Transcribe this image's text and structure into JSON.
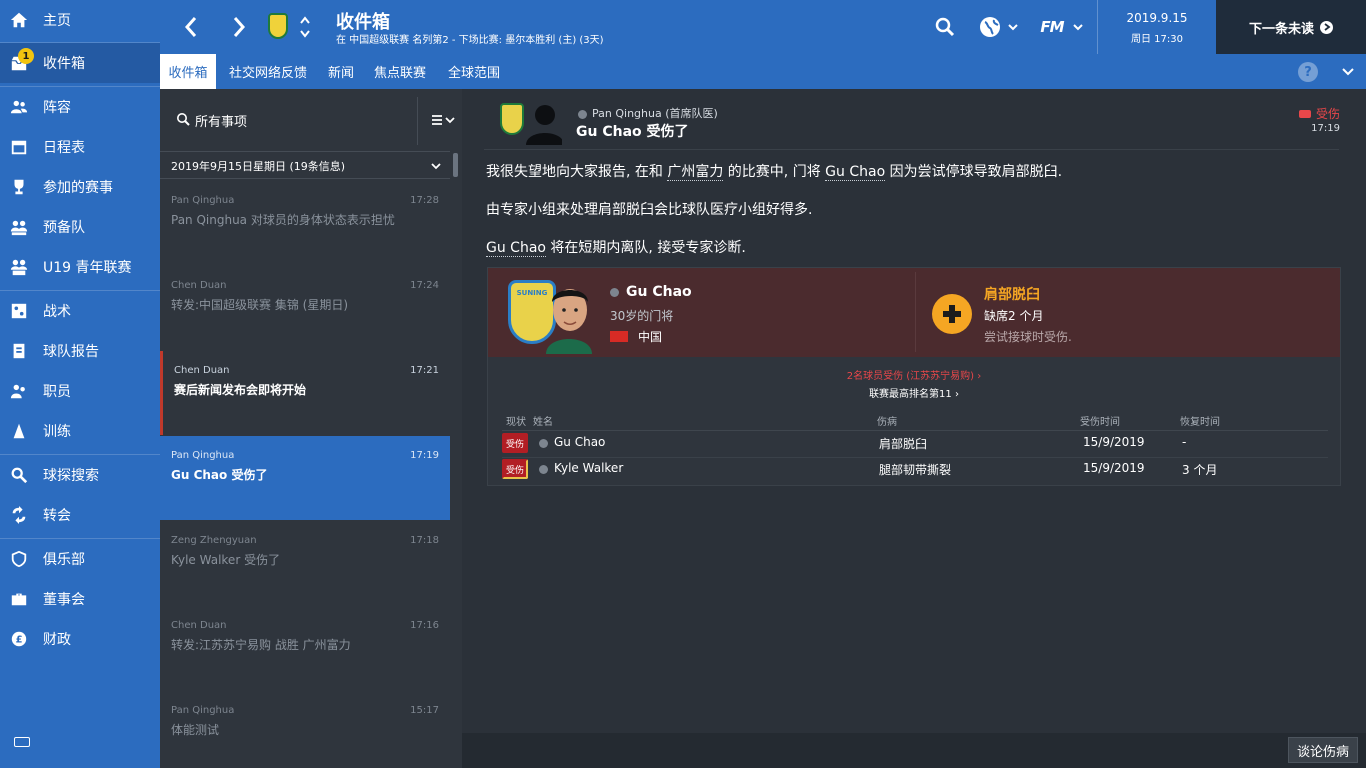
{
  "sidebar": {
    "items": [
      {
        "label": "主页",
        "icon": "home-icon",
        "badge": ""
      },
      {
        "label": "收件箱",
        "icon": "inbox-icon",
        "badge": "1"
      },
      {
        "label": "阵容",
        "icon": "squad-icon",
        "badge": ""
      },
      {
        "label": "日程表",
        "icon": "calendar-icon",
        "badge": ""
      },
      {
        "label": "参加的赛事",
        "icon": "trophy-icon",
        "badge": ""
      },
      {
        "label": "预备队",
        "icon": "reserves-icon",
        "badge": ""
      },
      {
        "label": "U19 青年联赛",
        "icon": "u19-icon",
        "badge": ""
      },
      {
        "label": "战术",
        "icon": "tactics-icon",
        "badge": ""
      },
      {
        "label": "球队报告",
        "icon": "report-icon",
        "badge": ""
      },
      {
        "label": "职员",
        "icon": "staff-icon",
        "badge": ""
      },
      {
        "label": "训练",
        "icon": "training-icon",
        "badge": ""
      },
      {
        "label": "球探搜索",
        "icon": "scouting-icon",
        "badge": ""
      },
      {
        "label": "转会",
        "icon": "transfers-icon",
        "badge": ""
      },
      {
        "label": "俱乐部",
        "icon": "club-icon",
        "badge": ""
      },
      {
        "label": "董事会",
        "icon": "board-icon",
        "badge": ""
      },
      {
        "label": "财政",
        "icon": "finance-icon",
        "badge": ""
      }
    ]
  },
  "header": {
    "title": "收件箱",
    "subtitle": "在 中国超级联赛 名列第2 - 下场比赛: 墨尔本胜利 (主) (3天)",
    "date": "2019.9.15",
    "day_time": "周日 17:30",
    "next_unread": "下一条未读",
    "fm_logo": "FM"
  },
  "tabs": [
    "收件箱",
    "社交网络反馈",
    "新闻",
    "焦点联赛",
    "全球范围"
  ],
  "help_label": "?",
  "list": {
    "filter_label": "所有事项",
    "date_group": "2019年9月15日星期日 (19条信息)",
    "messages": [
      {
        "from": "Pan Qinghua",
        "time": "17:28",
        "subject": "Pan Qinghua 对球员的身体状态表示担忧"
      },
      {
        "from": "Chen Duan",
        "time": "17:24",
        "subject": "转发:中国超级联赛 集锦 (星期日)"
      },
      {
        "from": "Chen Duan",
        "time": "17:21",
        "subject": "赛后新闻发布会即将开始"
      },
      {
        "from": "Pan Qinghua",
        "time": "17:19",
        "subject": "Gu Chao 受伤了"
      },
      {
        "from": "Zeng Zhengyuan",
        "time": "17:18",
        "subject": "Kyle Walker 受伤了"
      },
      {
        "from": "Chen Duan",
        "time": "17:16",
        "subject": "转发:江苏苏宁易购 战胜 广州富力"
      },
      {
        "from": "Pan Qinghua",
        "time": "15:17",
        "subject": "体能测试"
      }
    ]
  },
  "detail": {
    "from": "Pan Qinghua (首席队医)",
    "title": "Gu Chao 受伤了",
    "tag": "受伤",
    "time": "17:19",
    "p1_a": "我很失望地向大家报告, 在和 ",
    "p1_club": "广州富力",
    "p1_b": " 的比赛中, 门将 ",
    "p1_player": "Gu Chao",
    "p1_c": " 因为尝试停球导致肩部脱臼.",
    "p2": "由专家小组来处理肩部脱臼会比球队医疗小组好得多.",
    "p3_player": "Gu Chao",
    "p3_rest": " 将在短期内离队, 接受专家诊断.",
    "player": {
      "name": "Gu Chao",
      "age_position": "30岁的门将",
      "nation": "中国",
      "club_crest_text": "SUNING"
    },
    "injury": {
      "name": "肩部脱臼",
      "absence": "缺席2 个月",
      "cause": "尝试接球时受伤."
    },
    "summary_injured": "2名球员受伤 (江苏苏宁易购) ›",
    "summary_rank": "联赛最高排名第11 ›",
    "table": {
      "headers": {
        "status": "现状",
        "name": "姓名",
        "injury": "伤病",
        "date": "受伤时间",
        "recovery": "恢复时间"
      },
      "rows": [
        {
          "status": "受伤",
          "name": "Gu Chao",
          "injury": "肩部脱臼",
          "date": "15/9/2019",
          "recovery": "-"
        },
        {
          "status": "受伤",
          "name": "Kyle Walker",
          "injury": "腿部韧带撕裂",
          "date": "15/9/2019",
          "recovery": "3 个月"
        }
      ]
    }
  },
  "footer": {
    "discuss_button": "谈论伤病"
  },
  "colors": {
    "accent": "#2c6cbf",
    "injury_red": "#e8474a",
    "injury_orange": "#f5a623",
    "panel_dark": "#2b3139"
  }
}
